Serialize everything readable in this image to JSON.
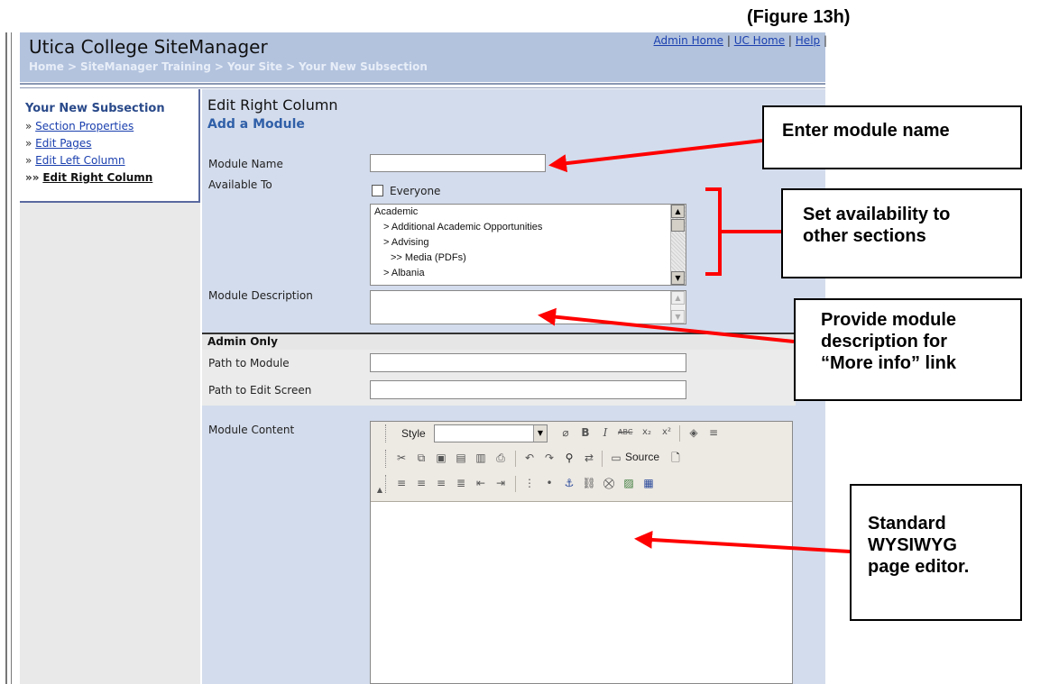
{
  "figure_label": "(Figure 13h)",
  "header": {
    "title": "Utica College SiteManager",
    "breadcrumb": [
      "Home",
      "SiteManager Training",
      "Your Site",
      "Your New Subsection"
    ],
    "links": [
      "Admin Home",
      "UC Home",
      "Help"
    ]
  },
  "sidebar": {
    "title": "Your New Subsection",
    "items": [
      {
        "prefix": "»",
        "label": "Section Properties"
      },
      {
        "prefix": "»",
        "label": "Edit Pages"
      },
      {
        "prefix": "»",
        "label": "Edit Left Column"
      },
      {
        "prefix": "»»",
        "label": "Edit Right Column"
      }
    ]
  },
  "main": {
    "title": "Edit Right Column",
    "subtitle": "Add a Module",
    "module_name_label": "Module Name",
    "module_name_value": "",
    "available_to_label": "Available To",
    "everyone_label": "Everyone",
    "sections": [
      "Academic",
      "> Additional Academic Opportunities",
      "> Advising",
      ">> Media (PDFs)",
      "> Albania"
    ],
    "module_description_label": "Module Description",
    "admin_only_label": "Admin Only",
    "path_to_module_label": "Path to Module",
    "path_to_edit_label": "Path to Edit Screen",
    "module_content_label": "Module Content",
    "editor": {
      "style_label": "Style",
      "style_value": "",
      "source_label": "Source"
    }
  },
  "callouts": {
    "module_name": "Enter module name",
    "availability": "Set availability to\nother sections",
    "description": "Provide module\ndescription for\n“More info” link",
    "wysiwyg": "Standard\nWYSIWYG\npage editor."
  },
  "colors": {
    "header_bg": "#b3c3de",
    "main_bg": "#d3dcec",
    "accent": "#2f5fa8",
    "arrow": "#ff0000"
  }
}
